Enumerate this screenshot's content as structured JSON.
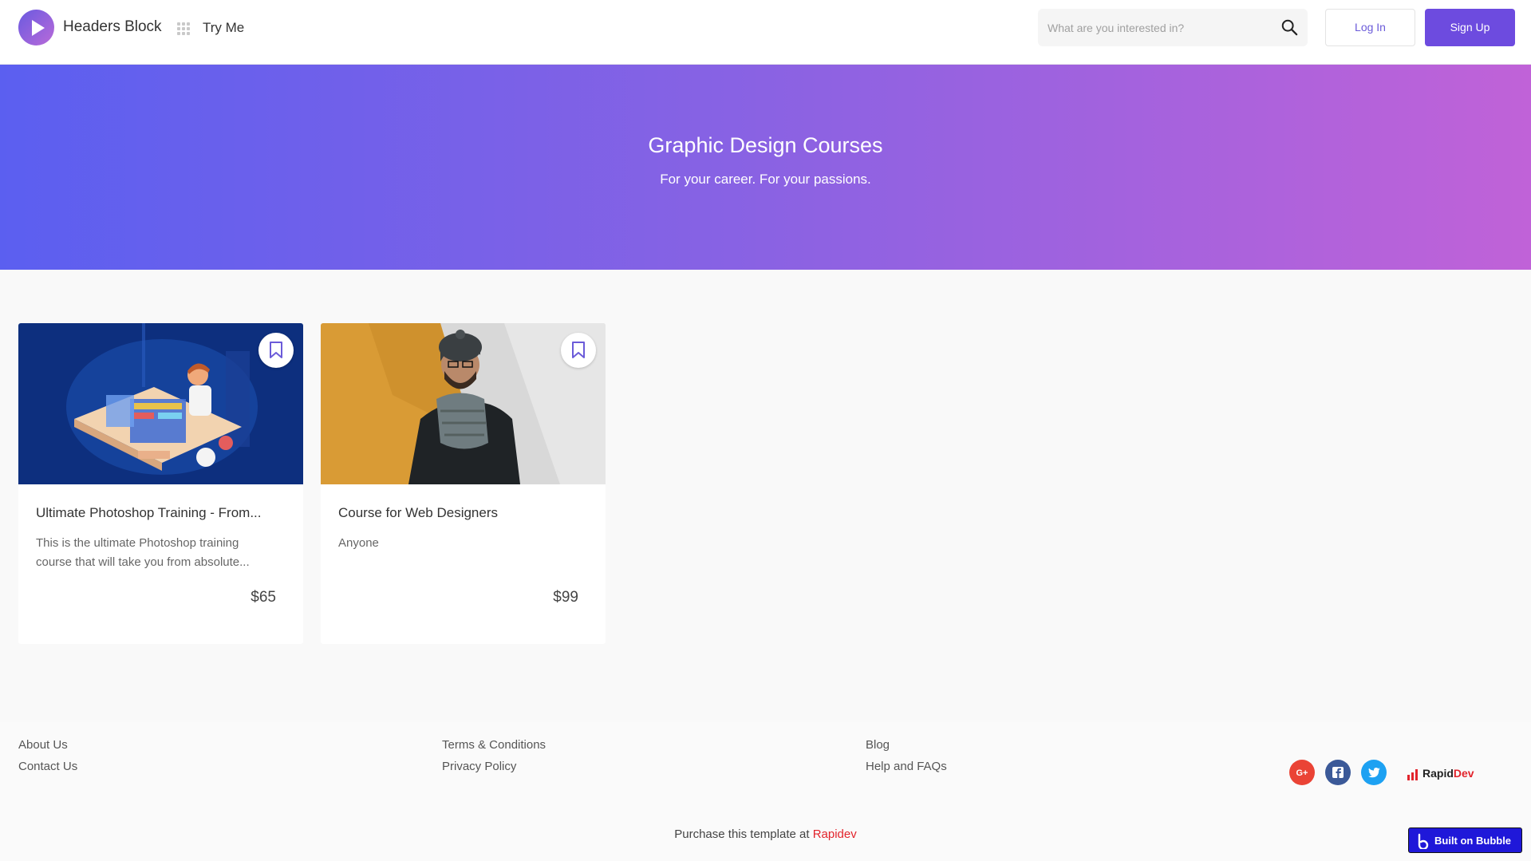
{
  "header": {
    "brand": "Headers Block",
    "try_me": "Try Me",
    "search_placeholder": "What are you interested in?",
    "login_label": "Log In",
    "signup_label": "Sign Up"
  },
  "hero": {
    "title": "Graphic Design Courses",
    "subtitle": "For your career. For your passions."
  },
  "courses": [
    {
      "title": "Ultimate Photoshop Training -  From...",
      "description": "This is the ultimate Photoshop training course that will take you from absolute...",
      "price": "$65"
    },
    {
      "title": "Course for Web Designers",
      "description": "Anyone",
      "price": "$99"
    }
  ],
  "footer": {
    "col1": [
      "About Us",
      "Contact Us"
    ],
    "col2": [
      "Terms & Conditions",
      "Privacy Policy"
    ],
    "col3": [
      "Blog",
      "Help and FAQs"
    ],
    "social": [
      "google-plus-icon",
      "facebook-icon",
      "twitter-icon"
    ],
    "rapid_logo": {
      "part1": "Rapid",
      "part2": "Dev"
    },
    "purchase_text": "Purchase this template at ",
    "purchase_link": "Rapidev",
    "bubble_badge": "Built on Bubble"
  },
  "colors": {
    "primary": "#6d4bdf",
    "hero_start": "#5b5ff0",
    "hero_end": "#c062d8",
    "link_red": "#e2242c",
    "google": "#ea4335",
    "facebook": "#3b5998",
    "twitter": "#1da1f2"
  }
}
